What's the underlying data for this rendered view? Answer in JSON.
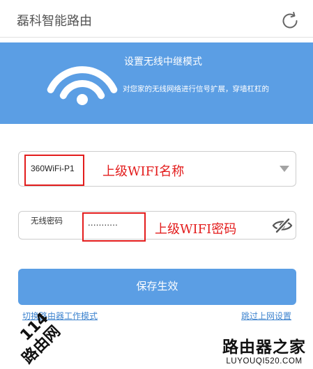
{
  "header": {
    "title": "磊科智能路由",
    "refresh_icon": "refresh-icon"
  },
  "banner": {
    "icon": "wifi-icon",
    "title": "设置无线中继模式",
    "subtitle": "对您家的无线网络进行信号扩展，穿墙杠杠的"
  },
  "form": {
    "ssid_select": {
      "selected_value": "360WiFi-P1",
      "icon": "dropdown-arrow-icon"
    },
    "password_field": {
      "label": "无线密码",
      "masked_value": "...........",
      "visibility_icon": "eye-slash-icon"
    },
    "save_button": {
      "label": "保存生效"
    }
  },
  "links": {
    "switch_mode": "切换路由器工作模式",
    "skip_setup": "跳过上网设置"
  },
  "annotations": {
    "ssid_note": "上级WIFI名称",
    "password_note": "上级WIFI密码"
  },
  "watermarks": {
    "left_number": "114",
    "left_name": "路由网",
    "right_name": "路由器之家",
    "right_url": "LUYOUQI520.COM"
  },
  "colors": {
    "primary_blue": "#5b9ee4",
    "link_blue": "#3f84cf",
    "annotation_red": "#e31c1c",
    "header_text": "#555555"
  }
}
